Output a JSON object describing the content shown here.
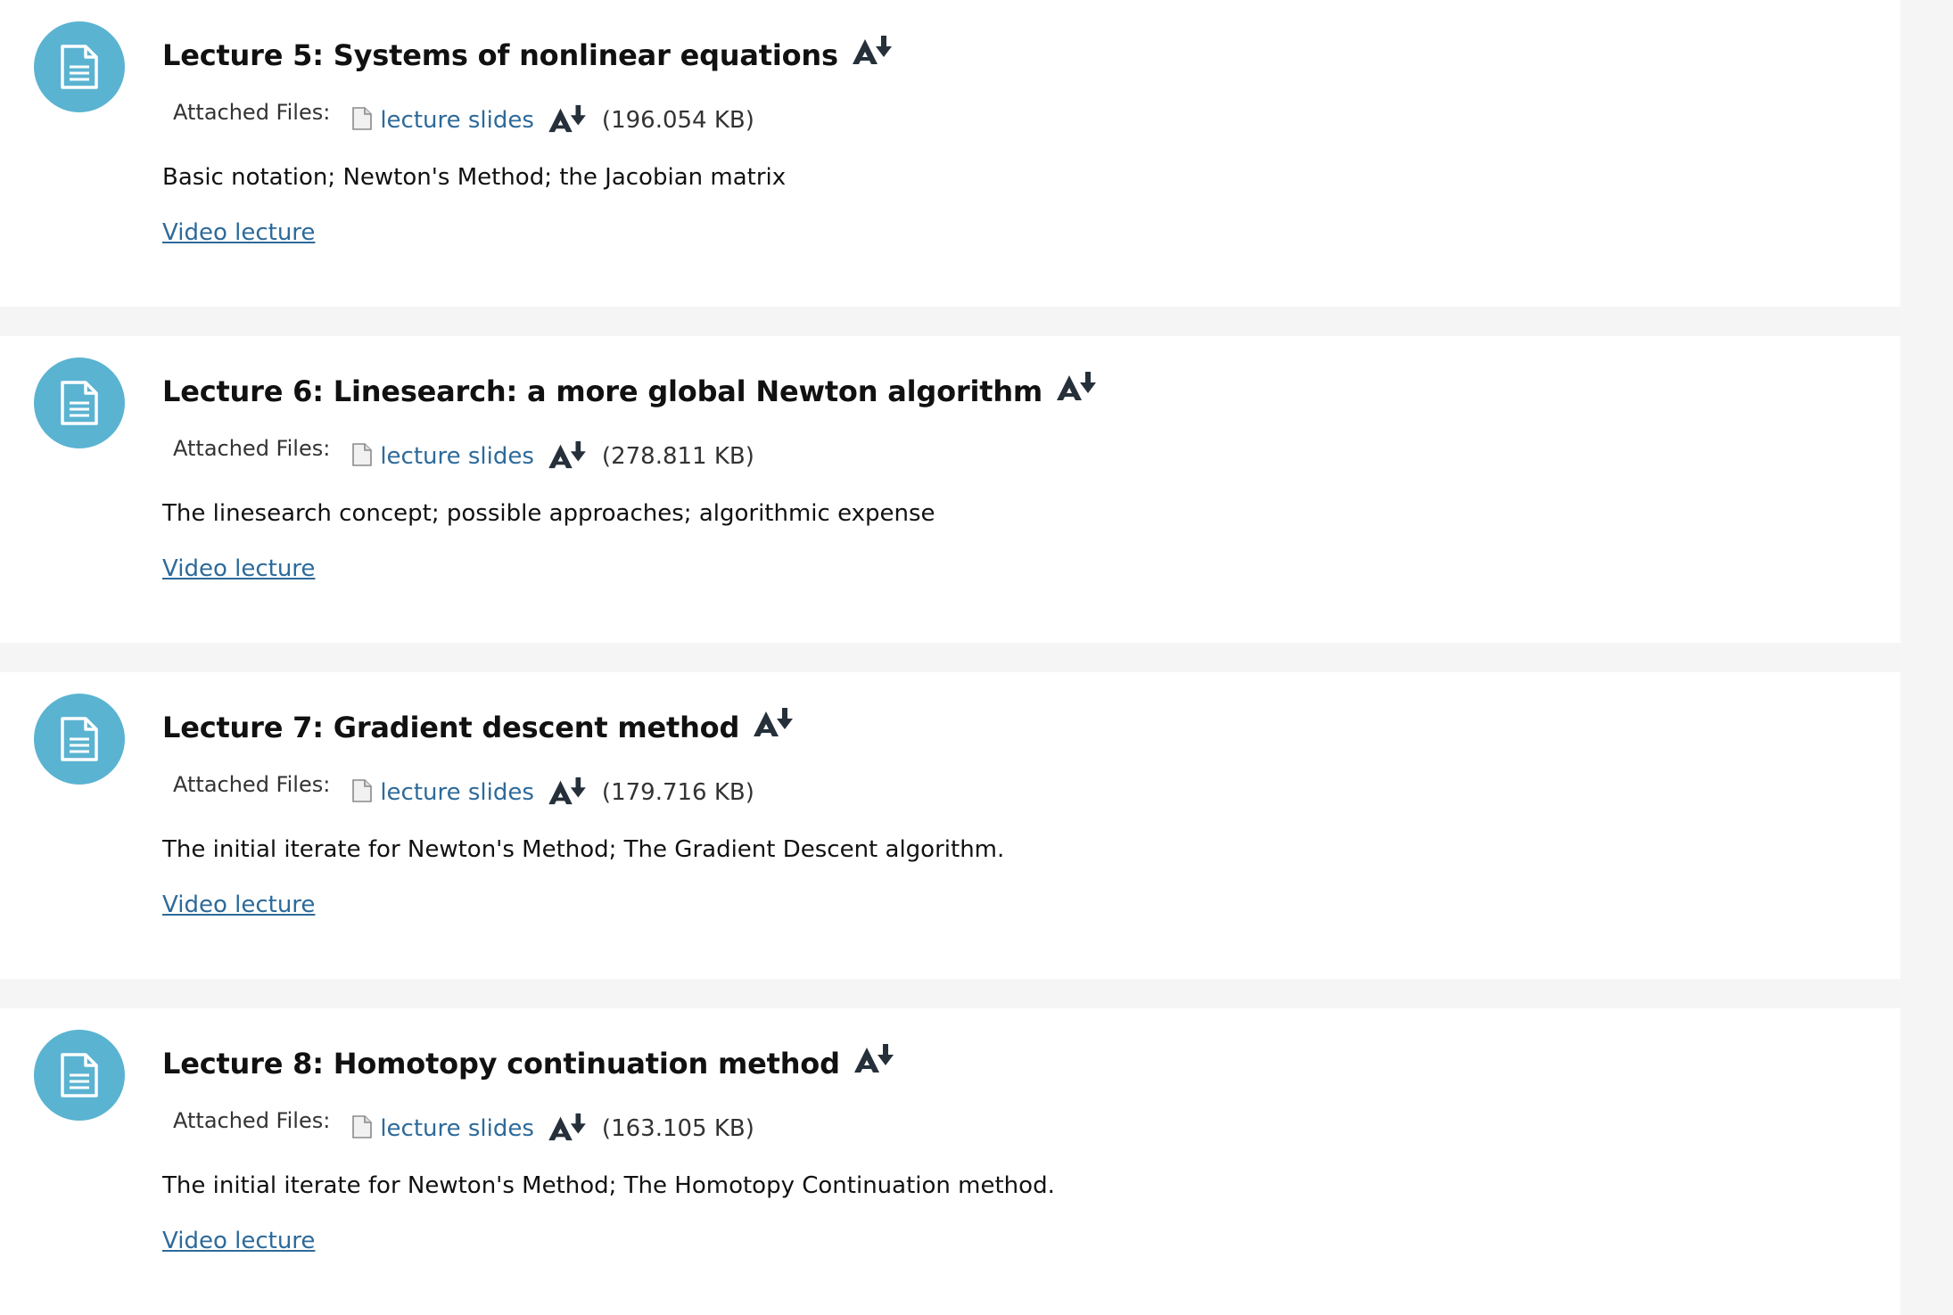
{
  "items": [
    {
      "title": "Lecture 5: Systems of nonlinear equations",
      "attached_files_label": "Attached Files:",
      "file_link": "lecture slides",
      "file_size": "(196.054 KB)",
      "description": "Basic notation; Newton's Method; the Jacobian matrix",
      "video_link": "Video lecture"
    },
    {
      "title": "Lecture 6: Linesearch: a more global Newton algorithm",
      "attached_files_label": "Attached Files:",
      "file_link": "lecture slides",
      "file_size": "(278.811 KB)",
      "description": "The linesearch concept; possible approaches; algorithmic expense",
      "video_link": "Video lecture"
    },
    {
      "title": "Lecture 7: Gradient descent method",
      "attached_files_label": "Attached Files:",
      "file_link": "lecture slides",
      "file_size": "(179.716 KB)",
      "description": "The initial iterate for Newton's Method; The Gradient Descent algorithm.",
      "video_link": "Video lecture"
    },
    {
      "title": "Lecture 8: Homotopy continuation method",
      "attached_files_label": "Attached Files:",
      "file_link": "lecture slides",
      "file_size": "(163.105 KB)",
      "description": "The initial iterate for Newton's Method; The Homotopy Continuation method.",
      "video_link": "Video lecture"
    }
  ],
  "icons": {
    "item_icon": "document-icon",
    "alternative_formats_icon": "alternative-formats-download-icon",
    "file_icon": "file-icon"
  },
  "colors": {
    "page_background": "#f5f5f5",
    "card_background": "#ffffff",
    "icon_circle": "#5ab3d1",
    "link": "#2d6a9a",
    "text": "#111111"
  }
}
